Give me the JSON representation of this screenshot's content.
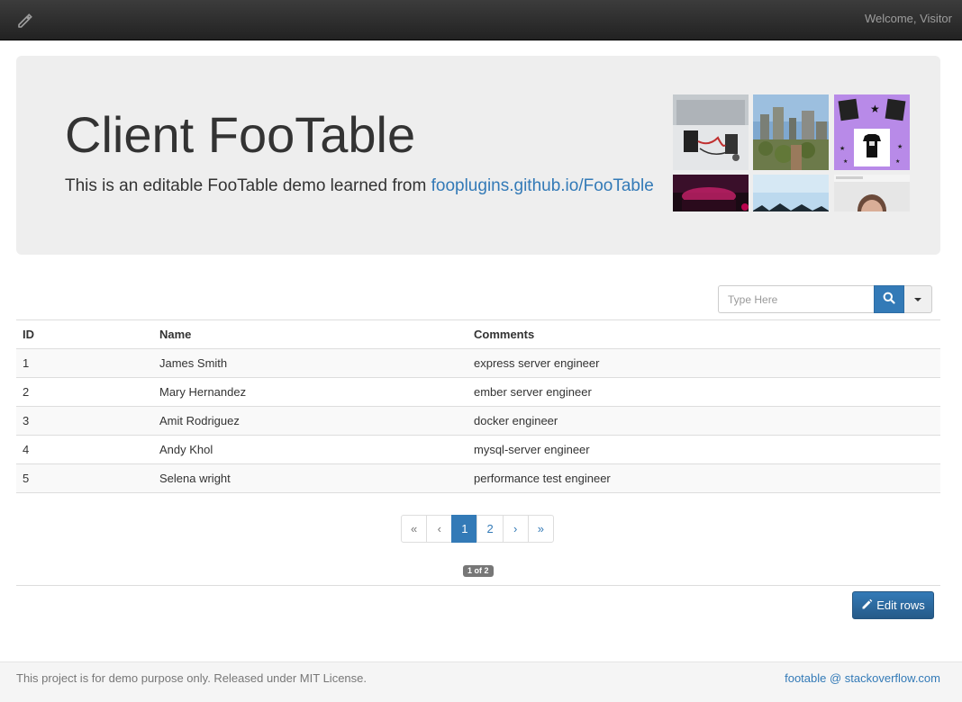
{
  "navbar": {
    "brand_icon": "pencil-icon",
    "welcome": "Welcome, Visitor"
  },
  "jumbotron": {
    "title": "Client FooTable",
    "lead_text": "This is an editable FooTable demo learned from ",
    "lead_link": "fooplugins.github.io/FooTable",
    "gallery": [
      {
        "icon": "laptop-electronics-photo"
      },
      {
        "icon": "city-skyline-photo"
      },
      {
        "icon": "tshirt-collage-photo"
      },
      {
        "icon": "dark-pink-light-photo"
      },
      {
        "icon": "sky-mountain-photo"
      },
      {
        "icon": "person-portrait-photo"
      }
    ]
  },
  "search": {
    "placeholder": "Type Here",
    "button_icon": "search-icon",
    "dropdown_icon": "caret-down-icon"
  },
  "table": {
    "headers": {
      "id": "ID",
      "name": "Name",
      "comments": "Comments"
    },
    "rows": [
      {
        "id": "1",
        "name": "James Smith",
        "comments": "express server engineer"
      },
      {
        "id": "2",
        "name": "Mary Hernandez",
        "comments": "ember server engineer"
      },
      {
        "id": "3",
        "name": "Amit Rodriguez",
        "comments": "docker engineer"
      },
      {
        "id": "4",
        "name": "Andy Khol",
        "comments": "mysql-server engineer"
      },
      {
        "id": "5",
        "name": "Selena wright",
        "comments": "performance test engineer"
      }
    ]
  },
  "pagination": {
    "first": "«",
    "prev": "‹",
    "pages": [
      "1",
      "2"
    ],
    "active_page": "1",
    "next": "›",
    "last": "»",
    "badge": "1 of 2"
  },
  "actions": {
    "edit_rows": "Edit rows",
    "edit_icon": "pencil-icon"
  },
  "footer": {
    "text": "This project is for demo purpose only. Released under MIT License.",
    "link": "footable @ stackoverflow.com"
  },
  "colors": {
    "primary": "#337ab7",
    "navbar": "#222222",
    "jumbotron": "#eeeeee",
    "muted": "#777777"
  }
}
